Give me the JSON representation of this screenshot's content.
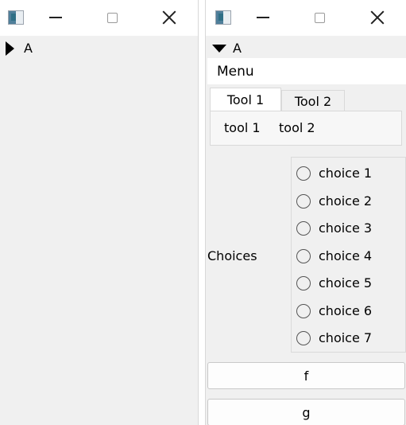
{
  "left_window": {
    "tree": {
      "label": "A",
      "expanded": false
    }
  },
  "right_window": {
    "tree": {
      "label": "A",
      "expanded": true
    },
    "menu": {
      "label": "Menu"
    },
    "tabs": [
      {
        "label": "Tool 1",
        "active": true
      },
      {
        "label": "Tool 2",
        "active": false
      }
    ],
    "tools": [
      "tool 1",
      "tool 2"
    ],
    "choices": {
      "label": "Choices",
      "options": [
        "choice 1",
        "choice 2",
        "choice 3",
        "choice 4",
        "choice 5",
        "choice 6",
        "choice 7"
      ]
    },
    "buttons": [
      "f",
      "g"
    ]
  }
}
